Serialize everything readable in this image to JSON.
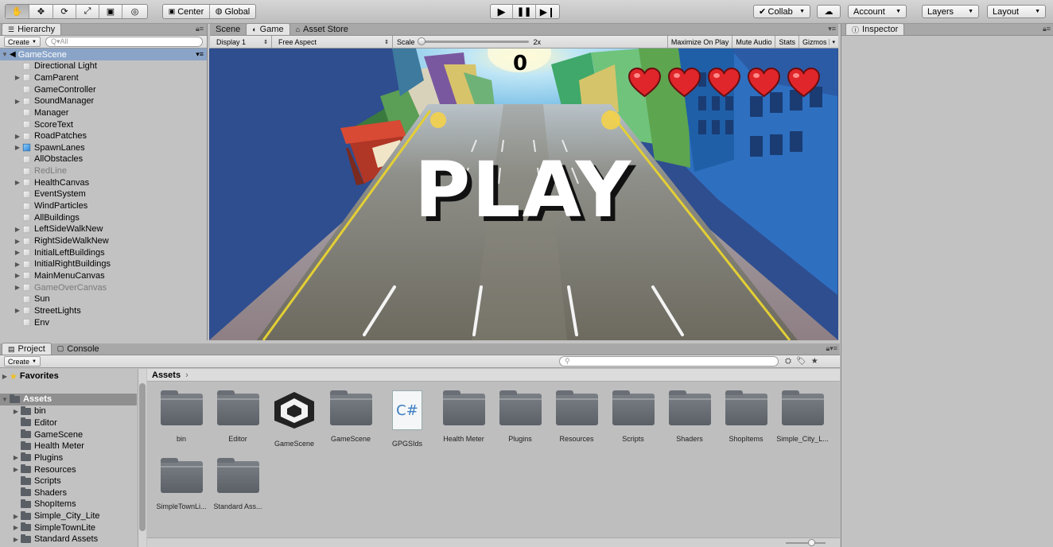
{
  "toolbar": {
    "tools": [
      "hand-tool",
      "move-tool",
      "rotate-tool",
      "scale-tool",
      "rect-tool",
      "transform-tool"
    ],
    "pivot_center": "Center",
    "pivot_global": "Global",
    "collab": "Collab",
    "account": "Account",
    "layers": "Layers",
    "layout": "Layout"
  },
  "hierarchy": {
    "tab": "Hierarchy",
    "create": "Create",
    "search_placeholder": "Q▾All",
    "scene": "GameScene",
    "items": [
      {
        "label": "Directional Light",
        "fold": false,
        "dim": false,
        "blue": false
      },
      {
        "label": "CamParent",
        "fold": true,
        "dim": false,
        "blue": false
      },
      {
        "label": "GameController",
        "fold": false,
        "dim": false,
        "blue": false
      },
      {
        "label": "SoundManager",
        "fold": true,
        "dim": false,
        "blue": false
      },
      {
        "label": "Manager",
        "fold": false,
        "dim": false,
        "blue": false
      },
      {
        "label": "ScoreText",
        "fold": false,
        "dim": false,
        "blue": false
      },
      {
        "label": "RoadPatches",
        "fold": true,
        "dim": false,
        "blue": false
      },
      {
        "label": "SpawnLanes",
        "fold": true,
        "dim": false,
        "blue": true
      },
      {
        "label": "AllObstacles",
        "fold": false,
        "dim": false,
        "blue": false
      },
      {
        "label": "RedLine",
        "fold": false,
        "dim": true,
        "blue": false
      },
      {
        "label": "HealthCanvas",
        "fold": true,
        "dim": false,
        "blue": false
      },
      {
        "label": "EventSystem",
        "fold": false,
        "dim": false,
        "blue": false
      },
      {
        "label": "WindParticles",
        "fold": false,
        "dim": false,
        "blue": false
      },
      {
        "label": "AllBuildings",
        "fold": false,
        "dim": false,
        "blue": false
      },
      {
        "label": "LeftSideWalkNew",
        "fold": true,
        "dim": false,
        "blue": false
      },
      {
        "label": "RightSideWalkNew",
        "fold": true,
        "dim": false,
        "blue": false
      },
      {
        "label": "InitialLeftBuildings",
        "fold": true,
        "dim": false,
        "blue": false
      },
      {
        "label": "InitialRightBuildings",
        "fold": true,
        "dim": false,
        "blue": false
      },
      {
        "label": "MainMenuCanvas",
        "fold": true,
        "dim": false,
        "blue": false
      },
      {
        "label": "GameOverCanvas",
        "fold": true,
        "dim": true,
        "blue": false
      },
      {
        "label": "Sun",
        "fold": false,
        "dim": false,
        "blue": false
      },
      {
        "label": "StreetLights",
        "fold": true,
        "dim": false,
        "blue": false
      },
      {
        "label": "Env",
        "fold": false,
        "dim": false,
        "blue": false
      }
    ]
  },
  "game": {
    "tabs": [
      "Scene",
      "Game",
      "Asset Store"
    ],
    "display": "Display 1",
    "aspect": "Free Aspect",
    "scale_label": "Scale",
    "scale_value": "2x",
    "maximize": "Maximize On Play",
    "mute": "Mute Audio",
    "stats": "Stats",
    "gizmos": "Gizmos",
    "score": "0",
    "play_text": "PLAY",
    "hearts": 5
  },
  "project": {
    "tabs": [
      "Project",
      "Console"
    ],
    "create": "Create",
    "favorites": "Favorites",
    "assets_root": "Assets",
    "breadcrumb": "Assets",
    "tree": [
      {
        "label": "bin",
        "fold": true
      },
      {
        "label": "Editor",
        "fold": false
      },
      {
        "label": "GameScene",
        "fold": false
      },
      {
        "label": "Health Meter",
        "fold": false
      },
      {
        "label": "Plugins",
        "fold": true
      },
      {
        "label": "Resources",
        "fold": true
      },
      {
        "label": "Scripts",
        "fold": false
      },
      {
        "label": "Shaders",
        "fold": false
      },
      {
        "label": "ShopItems",
        "fold": false
      },
      {
        "label": "Simple_City_Lite",
        "fold": true
      },
      {
        "label": "SimpleTownLite",
        "fold": true
      },
      {
        "label": "Standard Assets",
        "fold": true
      }
    ],
    "assets": [
      {
        "label": "bin",
        "kind": "folder"
      },
      {
        "label": "Editor",
        "kind": "folder"
      },
      {
        "label": "GameScene",
        "kind": "unity"
      },
      {
        "label": "GameScene",
        "kind": "folder"
      },
      {
        "label": "GPGSIds",
        "kind": "cs"
      },
      {
        "label": "Health Meter",
        "kind": "folder"
      },
      {
        "label": "Plugins",
        "kind": "folder"
      },
      {
        "label": "Resources",
        "kind": "folder"
      },
      {
        "label": "Scripts",
        "kind": "folder"
      },
      {
        "label": "Shaders",
        "kind": "folder"
      },
      {
        "label": "ShopItems",
        "kind": "folder"
      },
      {
        "label": "Simple_City_L...",
        "kind": "folder"
      },
      {
        "label": "SimpleTownLi...",
        "kind": "folder"
      },
      {
        "label": "Standard Ass...",
        "kind": "folder"
      }
    ]
  },
  "inspector": {
    "tab": "Inspector"
  }
}
